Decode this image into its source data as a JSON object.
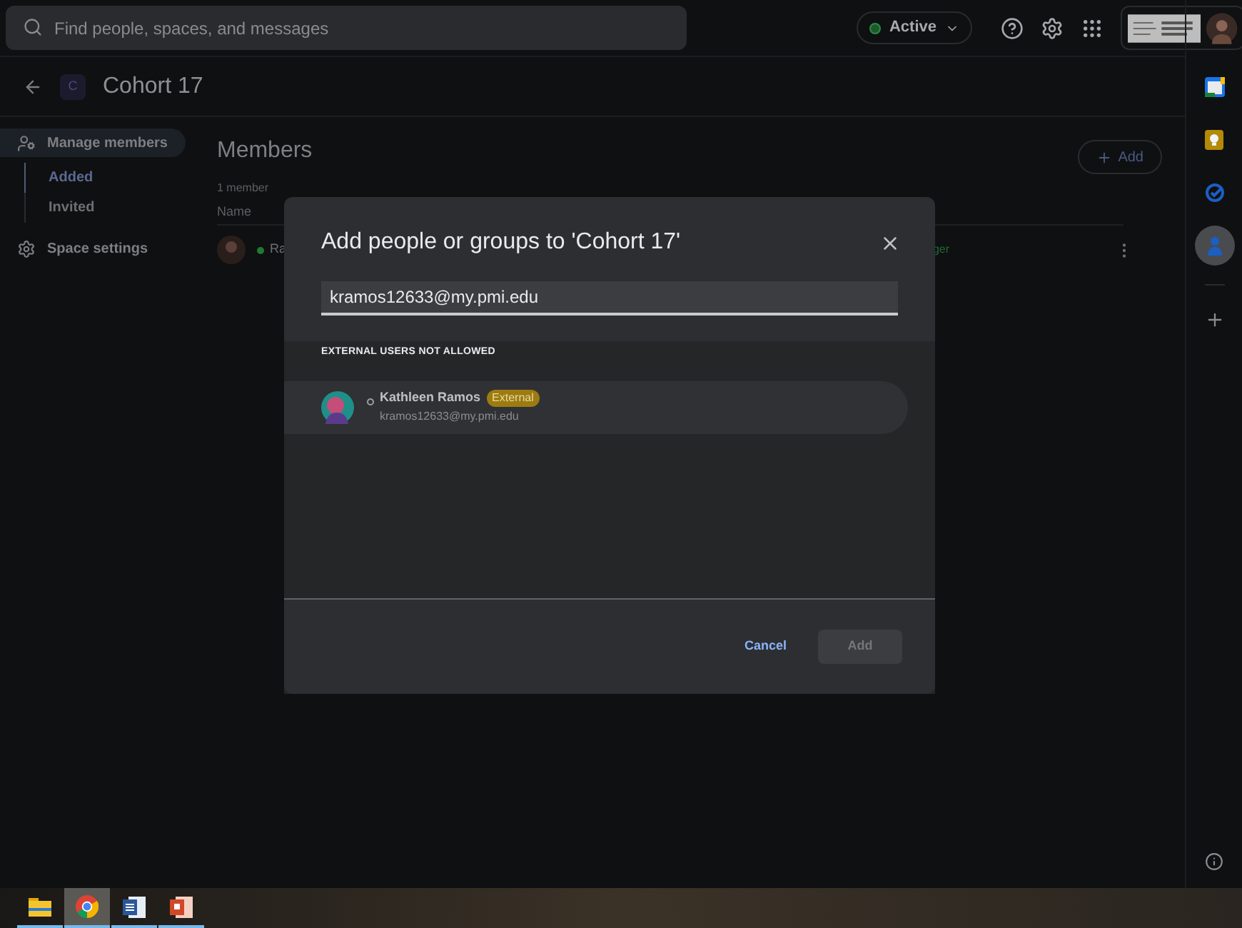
{
  "search": {
    "placeholder": "Find people, spaces, and messages"
  },
  "status": {
    "label": "Active",
    "online": true
  },
  "space": {
    "initial": "C",
    "name": "Cohort 17"
  },
  "nav": [
    {
      "kind": "members",
      "label": "Manage members",
      "selected": true,
      "children": [
        {
          "label": "Added",
          "selected": true
        },
        {
          "label": "Invited",
          "selected": false
        }
      ]
    },
    {
      "kind": "settings",
      "label": "Space settings",
      "selected": false
    }
  ],
  "members": {
    "title": "Members",
    "count": "1 member",
    "add_button": "Add",
    "columns": [
      "Name"
    ],
    "rows": [
      {
        "name": "Ra",
        "role": "ger",
        "online": true
      }
    ]
  },
  "dialog": {
    "title": "Add people or groups to 'Cohort 17'",
    "input_value": "kramos12633@my.pmi.edu",
    "section": "EXTERNAL USERS NOT ALLOWED",
    "results": [
      {
        "name": "Kathleen Ramos",
        "badge": "External",
        "email": "kramos12633@my.pmi.edu",
        "online": false
      }
    ],
    "cancel": "Cancel",
    "add": {
      "label": "Add",
      "disabled": true
    }
  },
  "side_apps": [
    {
      "kind": "calendar",
      "selected": false
    },
    {
      "kind": "keep",
      "selected": false
    },
    {
      "kind": "tasks",
      "selected": false
    },
    {
      "kind": "contacts",
      "selected": true
    }
  ],
  "taskbar": [
    {
      "kind": "explorer",
      "selected": false
    },
    {
      "kind": "chrome",
      "selected": true
    },
    {
      "kind": "word",
      "selected": false
    },
    {
      "kind": "powerpoint",
      "selected": false
    }
  ]
}
